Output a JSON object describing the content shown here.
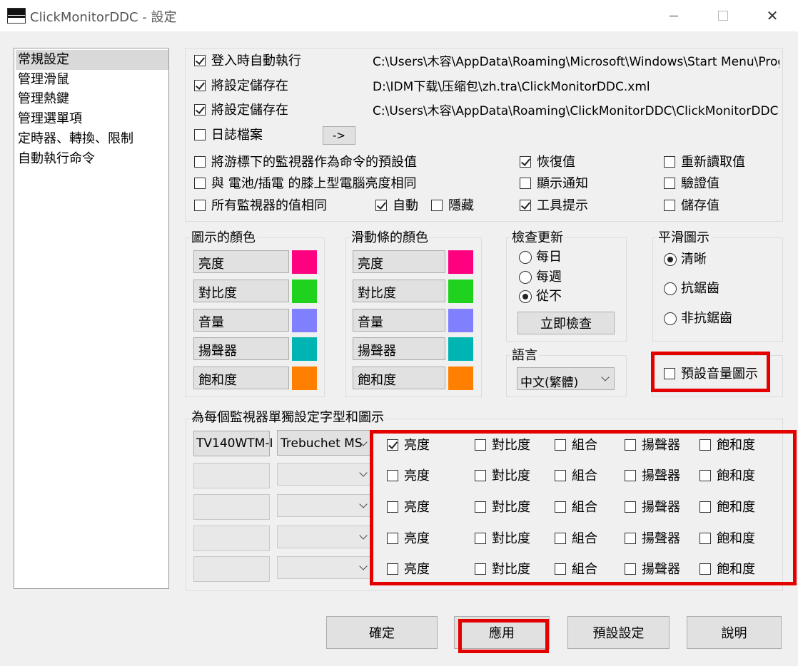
{
  "window": {
    "title": "ClickMonitorDDC - 設定",
    "minimize_icon": "minimize-icon",
    "maximize_icon": "maximize-icon",
    "close_glyph": "✕"
  },
  "nav": {
    "items": [
      "常規設定",
      "管理滑鼠",
      "管理熱鍵",
      "管理選單項",
      "定時器、轉換、限制",
      "自動執行命令"
    ],
    "selected": 0
  },
  "paths": {
    "autorun_label": "登入時自動執行",
    "autorun_path": "C:\\Users\\木容\\AppData\\Roaming\\Microsoft\\Windows\\Start Menu\\Progr",
    "save1_label": "將設定儲存在",
    "save1_path": "D:\\IDM下载\\压缩包\\zh.tra\\ClickMonitorDDC.xml",
    "save2_label": "將設定儲存在",
    "save2_path": "C:\\Users\\木容\\AppData\\Roaming\\ClickMonitorDDC\\ClickMonitorDDC.xm",
    "log_label": "日誌檔案",
    "log_button": "->"
  },
  "options": {
    "mouse_default": "將游標下的監視器作為命令的預設值",
    "battery_same": "與 電池/插電 的膝上型電腦亮度相同",
    "all_same": "所有監視器的值相同",
    "auto": "自動",
    "hide": "隱藏",
    "restore": "恢復值",
    "show_notify": "顯示通知",
    "tooltip": "工具提示",
    "reread": "重新讀取值",
    "verify": "驗證值",
    "store": "儲存值"
  },
  "icon_colors": {
    "title": "圖示的顏色",
    "items": [
      {
        "label": "亮度",
        "color": "#ff0080"
      },
      {
        "label": "對比度",
        "color": "#1ed21e"
      },
      {
        "label": "音量",
        "color": "#8080ff"
      },
      {
        "label": "揚聲器",
        "color": "#00b4b4"
      },
      {
        "label": "飽和度",
        "color": "#ff8000"
      }
    ]
  },
  "slider_colors": {
    "title": "滑動條的顏色",
    "items": [
      {
        "label": "亮度",
        "color": "#ff0080"
      },
      {
        "label": "對比度",
        "color": "#1ed21e"
      },
      {
        "label": "音量",
        "color": "#8080ff"
      },
      {
        "label": "揚聲器",
        "color": "#00b4b4"
      },
      {
        "label": "飽和度",
        "color": "#ff8000"
      }
    ]
  },
  "update_check": {
    "title": "檢查更新",
    "daily": "每日",
    "weekly": "每週",
    "never": "從不",
    "check_now": "立即檢查"
  },
  "smooth_icons": {
    "title": "平滑圖示",
    "clear": "清晰",
    "antialias": "抗鋸齒",
    "no_antialias": "非抗鋸齒"
  },
  "language": {
    "title": "語言",
    "value": "中文(繁體)"
  },
  "default_volume_icon": "預設音量圖示",
  "per_monitor": {
    "title": "為每個監視器單獨設定字型和圖示",
    "monitor_name": "TV140WTM-I",
    "font": "Trebuchet MS",
    "columns": [
      "亮度",
      "對比度",
      "組合",
      "揚聲器",
      "飽和度"
    ]
  },
  "footer": {
    "ok": "確定",
    "apply": "應用",
    "defaults": "預設設定",
    "help": "說明"
  }
}
